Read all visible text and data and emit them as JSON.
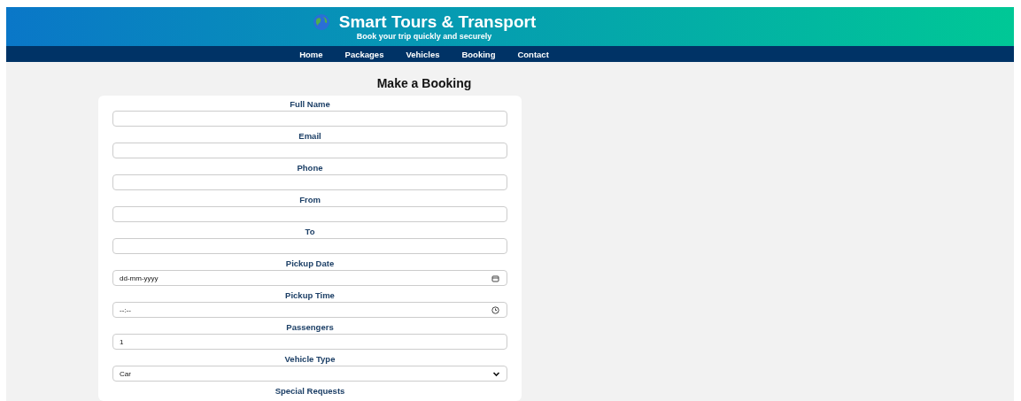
{
  "header": {
    "title": "Smart Tours & Transport",
    "subtitle": "Book your trip quickly and securely"
  },
  "nav": [
    "Home",
    "Packages",
    "Vehicles",
    "Booking",
    "Contact"
  ],
  "form": {
    "title": "Make a Booking",
    "fields": [
      {
        "label": "Full Name",
        "kind": "text"
      },
      {
        "label": "Email",
        "kind": "text"
      },
      {
        "label": "Phone",
        "kind": "text"
      },
      {
        "label": "From",
        "kind": "text"
      },
      {
        "label": "To",
        "kind": "text"
      },
      {
        "label": "Pickup Date",
        "kind": "date",
        "placeholder": "dd-mm-yyyy"
      },
      {
        "label": "Pickup Time",
        "kind": "time",
        "placeholder": "--:--"
      },
      {
        "label": "Passengers",
        "kind": "number",
        "value": "1"
      },
      {
        "label": "Vehicle Type",
        "kind": "select",
        "value": "Car"
      },
      {
        "label": "Special Requests",
        "kind": "label"
      }
    ]
  }
}
